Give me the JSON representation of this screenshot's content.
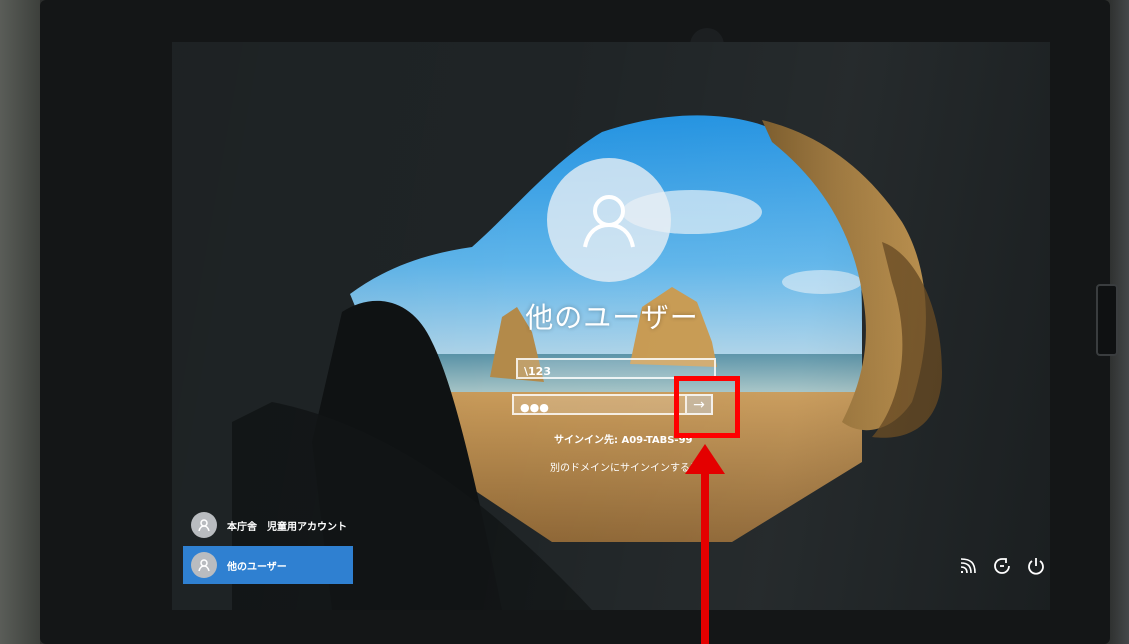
{
  "login": {
    "title": "他のユーザー",
    "username_value": "\\123",
    "password_mask": "●●●",
    "submit_icon": "arrow-right-icon",
    "signin_to": "サインイン先: A09-TABS-99",
    "other_domain_link": "別のドメインにサインインするには"
  },
  "user_list": [
    {
      "label": "本庁舎　児童用アカウント",
      "selected": false
    },
    {
      "label": "他のユーザー",
      "selected": true
    }
  ],
  "system_tray": {
    "icons": [
      "network-icon",
      "ease-of-access-icon",
      "power-icon"
    ]
  },
  "annotation": {
    "highlight_color": "#ff0000",
    "target": "submit-button"
  },
  "colors": {
    "selected_user_bg": "#2f80d1",
    "field_border": "#ffffff"
  }
}
